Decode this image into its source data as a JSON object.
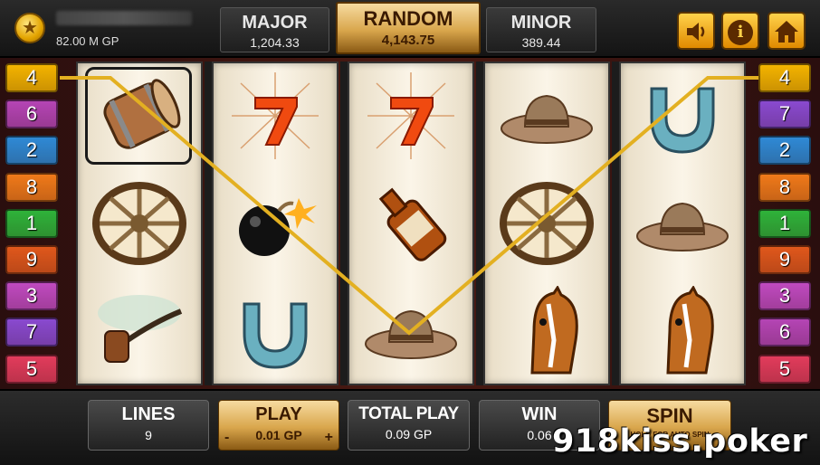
{
  "player": {
    "balance": "82.00 M GP"
  },
  "jackpots": {
    "major": {
      "label": "MAJOR",
      "value": "1,204.33"
    },
    "random": {
      "label": "RANDOM",
      "value": "4,143.75"
    },
    "minor": {
      "label": "MINOR",
      "value": "389.44"
    }
  },
  "top_buttons": {
    "info_label": "i"
  },
  "line_tabs": {
    "left": [
      {
        "label": "4",
        "color": "#f4b400"
      },
      {
        "label": "6",
        "color": "#b545b5"
      },
      {
        "label": "2",
        "color": "#2f8ad6"
      },
      {
        "label": "8",
        "color": "#f07a1a"
      },
      {
        "label": "1",
        "color": "#2fb33a"
      },
      {
        "label": "9",
        "color": "#e0581c"
      },
      {
        "label": "3",
        "color": "#c04ac0"
      },
      {
        "label": "7",
        "color": "#8a4ad0"
      },
      {
        "label": "5",
        "color": "#e23c5c"
      }
    ],
    "right": [
      {
        "label": "4",
        "color": "#f4b400"
      },
      {
        "label": "7",
        "color": "#8a4ad0"
      },
      {
        "label": "2",
        "color": "#2f8ad6"
      },
      {
        "label": "8",
        "color": "#f07a1a"
      },
      {
        "label": "1",
        "color": "#2fb33a"
      },
      {
        "label": "9",
        "color": "#e0581c"
      },
      {
        "label": "3",
        "color": "#c04ac0"
      },
      {
        "label": "6",
        "color": "#b545b5"
      },
      {
        "label": "5",
        "color": "#e23c5c"
      }
    ]
  },
  "reels": [
    [
      "barrel-icon",
      "wagon-wheel-icon",
      "pipe-icon"
    ],
    [
      "lucky-seven-icon",
      "bomb-icon",
      "horseshoe-icon"
    ],
    [
      "lucky-seven-icon",
      "whiskey-bottle-icon",
      "cowboy-hat-icon"
    ],
    [
      "cowboy-hat-icon",
      "wagon-wheel-icon",
      "horse-head-icon"
    ],
    [
      "horseshoe-icon",
      "cowboy-hat-icon",
      "horse-head-icon"
    ]
  ],
  "bottom": {
    "lines": {
      "label": "LINES",
      "value": "9"
    },
    "play": {
      "label": "PLAY",
      "value": "0.01 GP",
      "minus": "-",
      "plus": "+"
    },
    "total": {
      "label": "TOTAL PLAY",
      "value": "0.09 GP"
    },
    "win": {
      "label": "WIN",
      "value": "0.06"
    },
    "spin": {
      "label": "SPIN",
      "sub": "HOLD FOR AUTO SPIN"
    }
  },
  "watermark": "918kiss.poker",
  "colors": {
    "payline": "#e3b021",
    "gold": "#d9a64c"
  }
}
